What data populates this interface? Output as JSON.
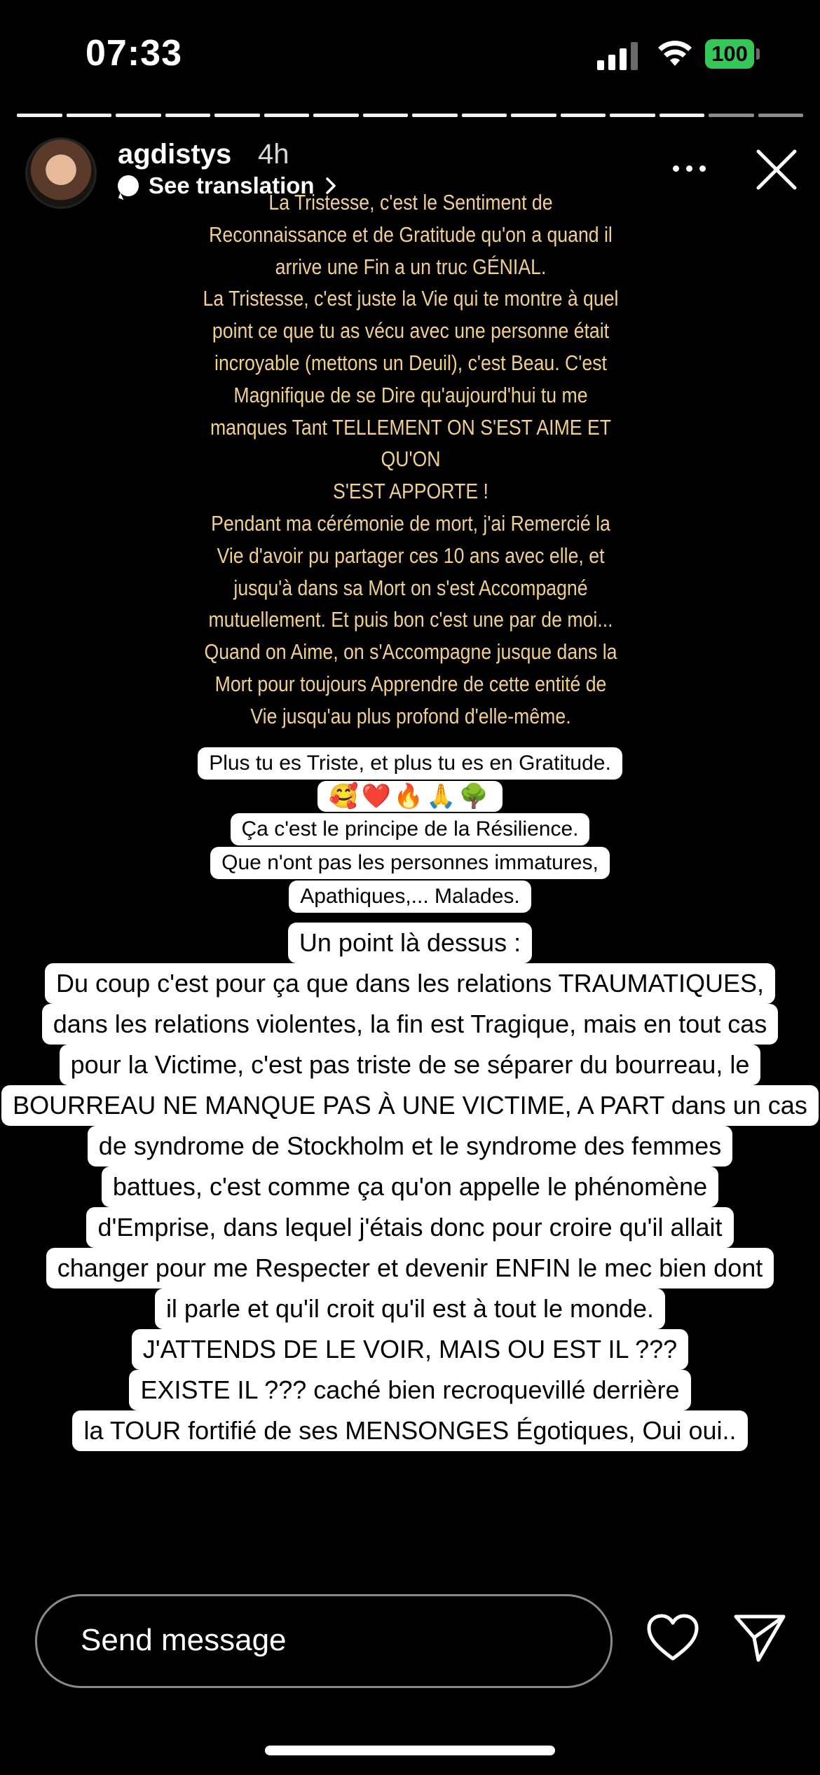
{
  "status_bar": {
    "time": "07:33",
    "battery": "100"
  },
  "story": {
    "progress_segments": 16,
    "seen_segments": 14,
    "username": "agdistys",
    "time_ago": "4h",
    "translation_label": "See translation",
    "gold_text": "La Tristesse, c'est le Sentiment de\nReconnaissance et de Gratitude qu'on a quand il\narrive une Fin a un truc GÉNIAL.\nLa Tristesse, c'est juste la Vie qui te montre à quel\npoint ce que tu as vécu avec une personne était\nincroyable (mettons un Deuil), c'est Beau. C'est\nMagnifique de se Dire qu'aujourd'hui tu me\nmanques Tant TELLEMENT ON S'EST AIME ET QU'ON\nS'EST APPORTE !\nPendant ma cérémonie de mort, j'ai Remercié la\nVie d'avoir pu partager ces 10 ans avec elle, et\njusqu'à dans sa Mort on s'est Accompagné\nmutuellement. Et puis bon c'est une par de moi...\nQuand on Aime, on s'Accompagne jusque dans la\nMort pour toujours Apprendre de cette entité de\nVie jusqu'au plus profond d'elle-même.",
    "box1_line1": "Plus tu es Triste, et plus tu es en Gratitude.",
    "emojis": "🥰❤️🔥🙏🌳",
    "box1_lines": [
      "Ça c'est le principe de la Résilience.",
      "Que n'ont pas les personnes immatures,",
      "Apathiques,... Malades."
    ],
    "box2_lines": [
      "Un point là dessus :",
      "Du coup c'est pour ça que dans les relations TRAUMATIQUES,",
      "dans les relations violentes, la fin est Tragique, mais en tout cas",
      "pour la Victime, c'est pas triste de se séparer du bourreau, le",
      "BOURREAU NE MANQUE PAS À UNE VICTIME,  A PART dans un cas",
      "de syndrome de Stockholm et le syndrome des femmes",
      "battues, c'est comme ça qu'on appelle le phénomène",
      "d'Emprise, dans lequel j'étais donc pour croire qu'il allait",
      "changer pour me Respecter et devenir ENFIN le mec bien dont",
      "il parle et qu'il croit qu'il est à tout le monde.",
      "J'ATTENDS DE LE VOIR, MAIS OU EST IL ???",
      "EXISTE IL ??? caché bien recroquevillé derrière",
      "la TOUR  fortifié de ses MENSONGES Égotiques, Oui oui.."
    ]
  },
  "composer": {
    "placeholder": "Send message"
  },
  "icons": [
    "signal-icon",
    "wifi-icon",
    "battery-icon",
    "more-icon",
    "close-icon",
    "heart-icon",
    "send-icon"
  ]
}
